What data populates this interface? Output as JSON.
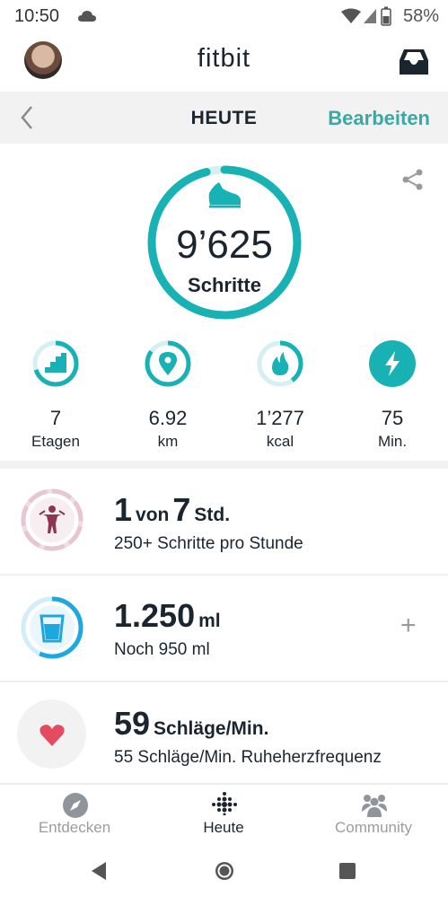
{
  "status_bar": {
    "time": "10:50",
    "battery": "58%"
  },
  "header": {
    "brand": "fitbit"
  },
  "date_bar": {
    "title": "HEUTE",
    "edit_label": "Bearbeiten"
  },
  "steps": {
    "value": "9’625",
    "label": "Schritte",
    "progress": 0.96
  },
  "stats": [
    {
      "value": "7",
      "label": "Etagen",
      "icon": "stairs-icon",
      "progress": 0.7
    },
    {
      "value": "6.92",
      "label": "km",
      "icon": "location-pin-icon",
      "progress": 0.85
    },
    {
      "value": "1’277",
      "label": "kcal",
      "icon": "flame-icon",
      "progress": 0.4
    },
    {
      "value": "75",
      "label": "Min.",
      "icon": "lightning-bolt-icon",
      "progress": 1.0
    }
  ],
  "tiles": {
    "hourly": {
      "value": "1",
      "mid": "von",
      "value2": "7",
      "unit": "Std.",
      "sub": "250+ Schritte pro Stunde"
    },
    "water": {
      "value": "1.250",
      "unit": "ml",
      "sub": "Noch 950 ml",
      "action": "+"
    },
    "heart": {
      "value": "59",
      "unit": "Schläge/Min.",
      "sub": "55 Schläge/Min. Ruheherzfrequenz"
    }
  },
  "bottom_nav": [
    {
      "label": "Entdecken",
      "icon": "compass-icon"
    },
    {
      "label": "Heute",
      "icon": "fitbit-dots-icon",
      "active": true
    },
    {
      "label": "Community",
      "icon": "community-icon"
    }
  ],
  "colors": {
    "teal": "#18b2b5",
    "teal_text": "#3ba8a3",
    "magenta": "#8e3553",
    "heart": "#e34b61",
    "water": "#1da8e0"
  }
}
